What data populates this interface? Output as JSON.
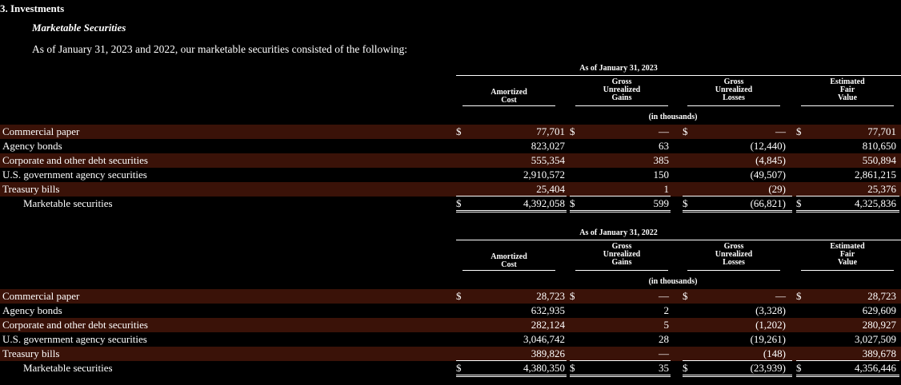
{
  "section_title": "3.   Investments",
  "subsection_title": "Marketable Securities",
  "intro_text": "As of January 31, 2023 and 2022, our marketable securities consisted of the following:",
  "tables": [
    {
      "as_of": "As of January 31, 2023",
      "headers": {
        "amortized_cost": [
          "Amortized",
          "Cost"
        ],
        "gross_gains": [
          "Gross",
          "Unrealized",
          "Gains"
        ],
        "gross_losses": [
          "Gross",
          "Unrealized",
          "Losses"
        ],
        "fair_value": [
          "Estimated",
          "Fair",
          "Value"
        ]
      },
      "units": "(in thousands)",
      "currency_symbol": "$",
      "rows": [
        {
          "label": "Commercial paper",
          "cost": "77,701",
          "gains": "—",
          "losses": "—",
          "fair": "77,701"
        },
        {
          "label": "Agency bonds",
          "cost": "823,027",
          "gains": "63",
          "losses": "(12,440)",
          "fair": "810,650"
        },
        {
          "label": "Corporate and other debt securities",
          "cost": "555,354",
          "gains": "385",
          "losses": "(4,845)",
          "fair": "550,894"
        },
        {
          "label": "U.S. government agency securities",
          "cost": "2,910,572",
          "gains": "150",
          "losses": "(49,507)",
          "fair": "2,861,215"
        },
        {
          "label": "Treasury bills",
          "cost": "25,404",
          "gains": "1",
          "losses": "(29)",
          "fair": "25,376"
        }
      ],
      "total": {
        "label": "Marketable securities",
        "cost": "4,392,058",
        "gains": "599",
        "losses": "(66,821)",
        "fair": "4,325,836"
      }
    },
    {
      "as_of": "As of January 31, 2022",
      "headers": {
        "amortized_cost": [
          "Amortized",
          "Cost"
        ],
        "gross_gains": [
          "Gross",
          "Unrealized",
          "Gains"
        ],
        "gross_losses": [
          "Gross",
          "Unrealized",
          "Losses"
        ],
        "fair_value": [
          "Estimated",
          "Fair",
          "Value"
        ]
      },
      "units": "(in thousands)",
      "currency_symbol": "$",
      "rows": [
        {
          "label": "Commercial paper",
          "cost": "28,723",
          "gains": "—",
          "losses": "—",
          "fair": "28,723"
        },
        {
          "label": "Agency bonds",
          "cost": "632,935",
          "gains": "2",
          "losses": "(3,328)",
          "fair": "629,609"
        },
        {
          "label": "Corporate and other debt securities",
          "cost": "282,124",
          "gains": "5",
          "losses": "(1,202)",
          "fair": "280,927"
        },
        {
          "label": "U.S. government agency securities",
          "cost": "3,046,742",
          "gains": "28",
          "losses": "(19,261)",
          "fair": "3,027,509"
        },
        {
          "label": "Treasury bills",
          "cost": "389,826",
          "gains": "—",
          "losses": "(148)",
          "fair": "389,678"
        }
      ],
      "total": {
        "label": "Marketable securities",
        "cost": "4,380,350",
        "gains": "35",
        "losses": "(23,939)",
        "fair": "4,356,446"
      }
    }
  ]
}
